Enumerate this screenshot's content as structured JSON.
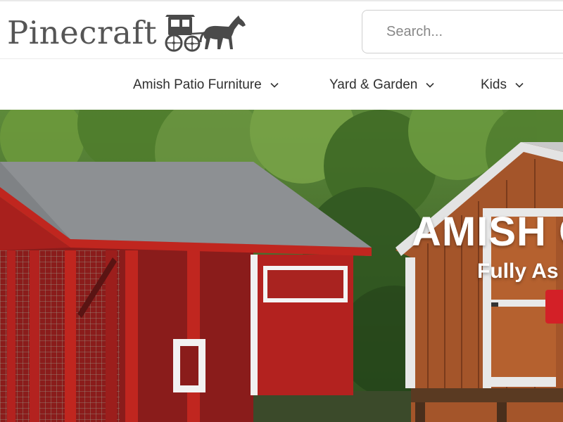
{
  "brand": {
    "name": "Pinecraft",
    "logo_icon": "horse-buggy-icon"
  },
  "search": {
    "placeholder": "Search...",
    "value": ""
  },
  "nav": {
    "items": [
      {
        "label": "Amish Patio Furniture",
        "icon": "chevron-down-icon"
      },
      {
        "label": "Yard & Garden",
        "icon": "chevron-down-icon"
      },
      {
        "label": "Kids",
        "icon": "chevron-down-icon"
      }
    ]
  },
  "hero": {
    "title": "AMISH C",
    "subtitle": "Fully As",
    "cta_color": "#d32027"
  },
  "colors": {
    "barn_red": "#b3221f",
    "stain_brown": "#a4552a",
    "roof_gray": "#7f8285",
    "foliage": "#3d6b2a"
  }
}
